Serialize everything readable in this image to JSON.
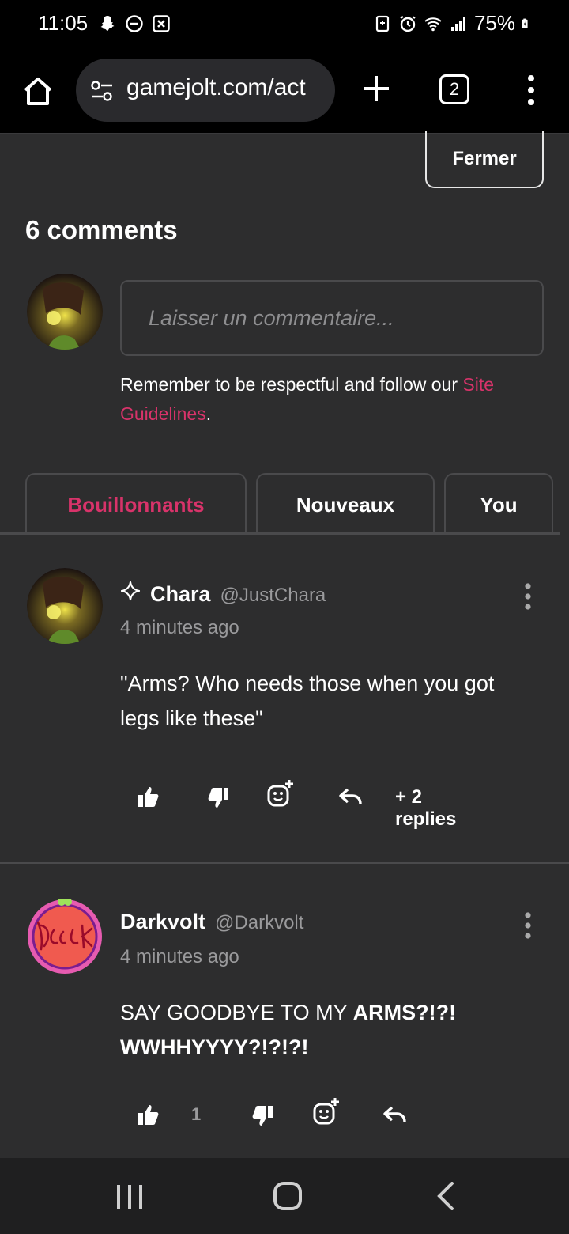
{
  "status_bar": {
    "time": "11:05",
    "battery": "75%",
    "left_icons": [
      "snapchat-icon",
      "dnd-icon",
      "close-box-icon"
    ],
    "right_icons": [
      "battery-saver-icon",
      "alarm-icon",
      "wifi-icon",
      "signal-icon",
      "battery-icon"
    ]
  },
  "browser": {
    "url": "gamejolt.com/act",
    "tab_count": "2"
  },
  "close_button": "Fermer",
  "comments_header": "6 comments",
  "composer": {
    "placeholder": "Laisser un commentaire...",
    "note": "Remember to be respectful and follow our ",
    "link_text": "Site Guidelines",
    "note_end": "."
  },
  "tabs": [
    {
      "label": "Bouillonnants",
      "active": true
    },
    {
      "label": "Nouveaux",
      "active": false
    },
    {
      "label": "You",
      "active": false
    }
  ],
  "comments": [
    {
      "name": "Chara",
      "handle": "@JustChara",
      "time": "4 minutes ago",
      "text": "\"Arms? Who needs those when you got legs like these\"",
      "likes": "",
      "replies": "+ 2 replies",
      "verified_icon": "sparkle-icon"
    },
    {
      "name": "Darkvolt",
      "handle": "@Darkvolt",
      "time": "4 minutes ago",
      "text_plain": "SAY GOODBYE TO MY ",
      "text_bold": "ARMS?!?! WWHHYYYY?!?!?!",
      "likes": "1",
      "replies": ""
    }
  ],
  "colors": {
    "accent": "#d8336a",
    "background": "#2d2d2e",
    "bar": "#000000"
  }
}
